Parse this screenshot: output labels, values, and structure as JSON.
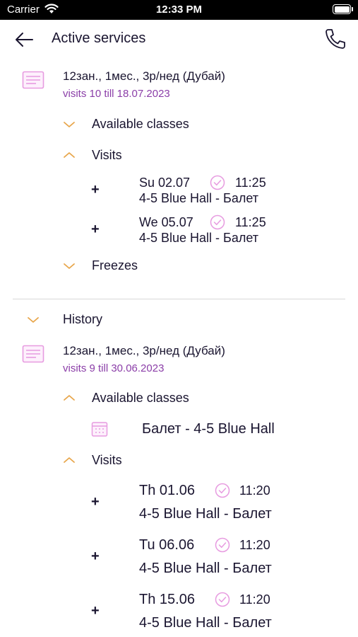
{
  "status_bar": {
    "carrier": "Carrier",
    "time": "12:33 PM"
  },
  "header": {
    "title": "Active services"
  },
  "active_service": {
    "name": "12зан., 1мес., 3р/нед (Дубай)",
    "subtitle": "visits 10 till 18.07.2023",
    "available_classes_label": "Available classes",
    "visits_label": "Visits",
    "visits": [
      {
        "date": "Su 02.07",
        "time": "11:25",
        "place": "4-5 Blue Hall - Балет"
      },
      {
        "date": "We 05.07",
        "time": "11:25",
        "place": "4-5 Blue Hall - Балет"
      }
    ],
    "freezes_label": "Freezes"
  },
  "history": {
    "label": "History",
    "service": {
      "name": "12зан., 1мес., 3р/нед (Дубай)",
      "subtitle": "visits 9 till 30.06.2023",
      "available_classes_label": "Available classes",
      "classes": [
        {
          "name": "Балет - 4-5 Blue Hall"
        }
      ],
      "visits_label": "Visits",
      "visits": [
        {
          "date": "Th 01.06",
          "time": "11:20",
          "place": "4-5 Blue Hall - Балет"
        },
        {
          "date": "Tu 06.06",
          "time": "11:20",
          "place": "4-5 Blue Hall - Балет"
        },
        {
          "date": "Th 15.06",
          "time": "11:20",
          "place": "4-5 Blue Hall - Балет"
        }
      ]
    }
  },
  "icons": {
    "back": "arrow-left-icon",
    "phone": "phone-icon",
    "document": "document-icon",
    "chevron": "chevron-icon",
    "check": "check-circle-icon",
    "calendar": "calendar-icon"
  },
  "colors": {
    "accent_purple": "#8b3ea8",
    "icon_pink": "#e79be0",
    "chevron_orange": "#e8a64b",
    "text_dark": "#1a1530",
    "divider": "#d9d9d9"
  }
}
